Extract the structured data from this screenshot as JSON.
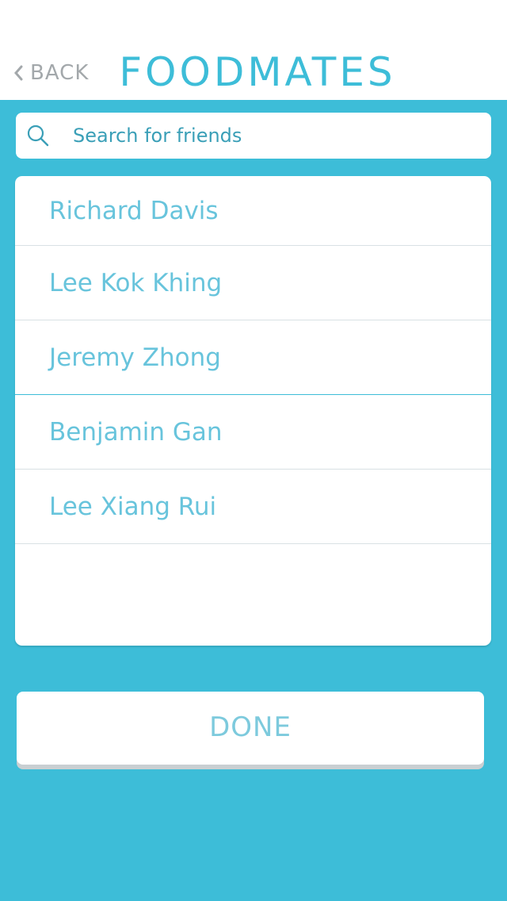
{
  "header": {
    "back_label": "BACK",
    "title": "FOODMATES"
  },
  "search": {
    "placeholder": "Search for friends"
  },
  "friends": [
    {
      "name": "Richard Davis"
    },
    {
      "name": "Lee Kok Khing"
    },
    {
      "name": "Jeremy Zhong"
    },
    {
      "name": "Benjamin Gan"
    },
    {
      "name": "Lee Xiang Rui"
    }
  ],
  "actions": {
    "done_label": "DONE"
  },
  "colors": {
    "accent": "#3dbdd8",
    "text_light": "#68c4dc",
    "muted": "#a3a8ab"
  }
}
